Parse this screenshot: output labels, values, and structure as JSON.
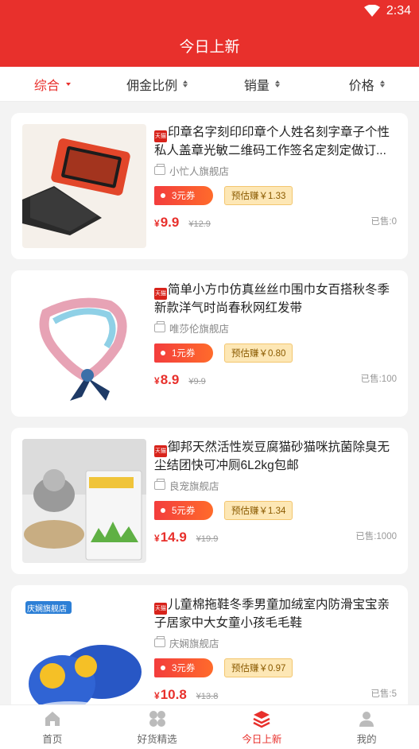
{
  "status_bar": {
    "time": "2:34"
  },
  "header": {
    "title": "今日上新"
  },
  "sort": {
    "items": [
      {
        "label": "综合",
        "active": true
      },
      {
        "label": "佣金比例",
        "active": false
      },
      {
        "label": "销量",
        "active": false
      },
      {
        "label": "价格",
        "active": false
      }
    ]
  },
  "products": [
    {
      "title": "印章名字刻印印章个人姓名刻字章子个性私人盖章光敏二维码工作签名定刻定做订...",
      "tmall_badge": "天猫",
      "shop": "小忙人旗舰店",
      "coupon": "3元券",
      "commission": "预估赚￥1.33",
      "price_symbol": "¥",
      "price": "9.9",
      "original_price": "¥12.9",
      "sold": "已售:0"
    },
    {
      "title": "简单小方巾仿真丝丝巾围巾女百搭秋冬季新款洋气时尚春秋网红发带",
      "tmall_badge": "天猫",
      "shop": "唯莎伦旗舰店",
      "coupon": "1元券",
      "commission": "预估赚￥0.80",
      "price_symbol": "¥",
      "price": "8.9",
      "original_price": "¥9.9",
      "sold": "已售:100"
    },
    {
      "title": "御邦天然活性炭豆腐猫砂猫咪抗菌除臭无尘结团快可冲厕6L2kg包邮",
      "tmall_badge": "天猫",
      "shop": "良宠旗舰店",
      "coupon": "5元券",
      "commission": "预估赚￥1.34",
      "price_symbol": "¥",
      "price": "14.9",
      "original_price": "¥19.9",
      "sold": "已售:1000"
    },
    {
      "title": "儿童棉拖鞋冬季男童加绒室内防滑宝宝亲子居家中大女童小孩毛毛鞋",
      "tmall_badge": "天猫",
      "shop": "庆娴旗舰店",
      "coupon": "3元券",
      "commission": "预估赚￥0.97",
      "price_symbol": "¥",
      "price": "10.8",
      "original_price": "¥13.8",
      "sold": "已售:5",
      "image_label": "庆娴旗舰店"
    }
  ],
  "tabbar": {
    "items": [
      {
        "label": "首页",
        "icon": "home-icon"
      },
      {
        "label": "好货精选",
        "icon": "grid-icon"
      },
      {
        "label": "今日上新",
        "icon": "layers-icon",
        "active": true
      },
      {
        "label": "我的",
        "icon": "user-icon"
      }
    ]
  },
  "colors": {
    "brand_red": "#e8302c",
    "commission_bg": "#fde7b5"
  }
}
